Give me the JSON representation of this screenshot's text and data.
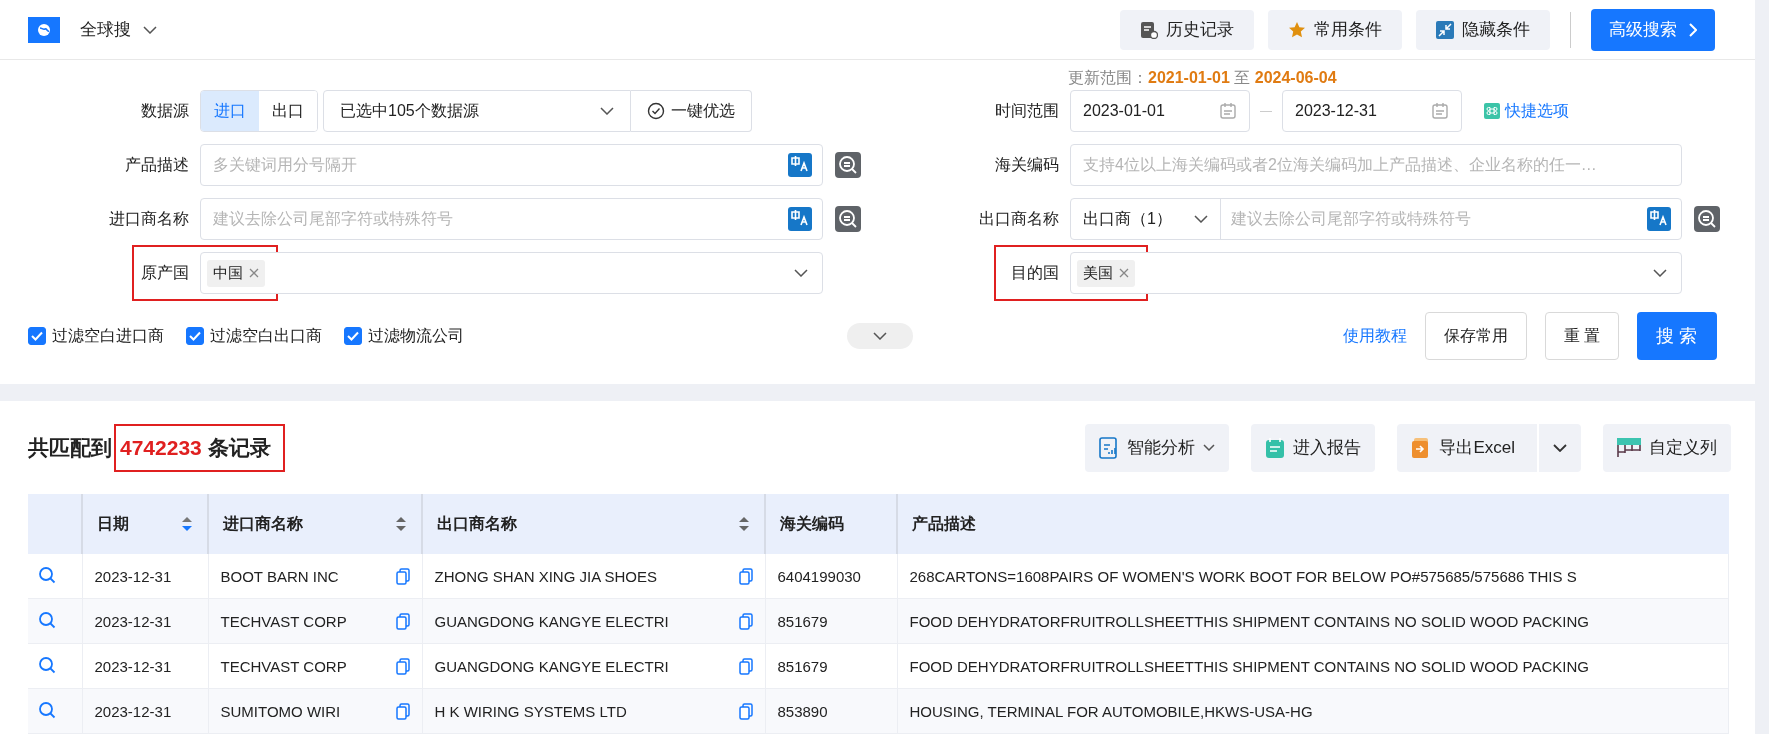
{
  "header": {
    "product": "全球搜",
    "buttons": [
      {
        "label": "历史记录",
        "kind": "history"
      },
      {
        "label": "常用条件",
        "kind": "star"
      },
      {
        "label": "隐藏条件",
        "kind": "collapse"
      }
    ],
    "advanced": "高级搜索"
  },
  "update_range": {
    "label": "更新范围：",
    "from": "2021-01-01",
    "sep": "至",
    "to": "2024-06-04"
  },
  "form_left": [
    {
      "kind": "source",
      "label": "数据源",
      "options": [
        {
          "label": "进口",
          "selected": true
        },
        {
          "label": "出口",
          "selected": false
        }
      ],
      "value": "已选中105个数据源",
      "action": "一键优选"
    },
    {
      "kind": "text",
      "label": "产品描述",
      "placeholder": "多关键词用分号隔开"
    },
    {
      "kind": "text",
      "label": "进口商名称",
      "placeholder": "建议去除公司尾部字符或特殊符号"
    },
    {
      "kind": "tags",
      "label": "原产国",
      "tags": [
        "中国"
      ],
      "highlighted": true
    }
  ],
  "form_right": [
    {
      "kind": "daterange",
      "label": "时间范围",
      "from": "2023-01-01",
      "to": "2023-12-31",
      "shortcut": "快捷选项"
    },
    {
      "kind": "plain",
      "label": "海关编码",
      "placeholder": "支持4位以上海关编码或者2位海关编码加上产品描述、企业名称的任一…"
    },
    {
      "kind": "prefixed",
      "label": "出口商名称",
      "prefix": "出口商（1）",
      "placeholder": "建议去除公司尾部字符或特殊符号"
    },
    {
      "kind": "tags",
      "label": "目的国",
      "tags": [
        "美国"
      ],
      "highlighted": true
    }
  ],
  "filters": [
    {
      "label": "过滤空白进口商",
      "checked": true
    },
    {
      "label": "过滤空白出口商",
      "checked": true
    },
    {
      "label": "过滤物流公司",
      "checked": true
    }
  ],
  "expand_toggle": {
    "expanded": false
  },
  "actions": {
    "tutorial": "使用教程",
    "save": "保存常用",
    "reset": "重 置",
    "search": "搜 索"
  },
  "results": {
    "prefix": "共匹配到",
    "count": "4742233",
    "suffix": "条记录",
    "highlighted": true
  },
  "toolbar": [
    {
      "label": "智能分析",
      "kind": "bi",
      "dropdown": true,
      "split": false
    },
    {
      "label": "进入报告",
      "kind": "report",
      "dropdown": false,
      "split": false
    },
    {
      "label": "导出Excel",
      "kind": "excel",
      "dropdown": false,
      "split": true
    },
    {
      "label": "自定义列",
      "kind": "columns",
      "dropdown": false,
      "split": false
    }
  ],
  "table": {
    "columns": [
      {
        "label": "日期",
        "sortable": true,
        "sorted": true
      },
      {
        "label": "进口商名称",
        "sortable": true,
        "sorted": false
      },
      {
        "label": "出口商名称",
        "sortable": true,
        "sorted": false
      },
      {
        "label": "海关编码",
        "sortable": false
      },
      {
        "label": "产品描述",
        "sortable": false
      }
    ],
    "rows": [
      {
        "cells": [
          "2023-12-31",
          "BOOT BARN INC",
          "ZHONG SHAN XING JIA SHOES",
          "6404199030",
          "268CARTONS=1608PAIRS OF WOMEN'S WORK BOOT FOR BELOW PO#575685/575686 THIS S"
        ]
      },
      {
        "cells": [
          "2023-12-31",
          "TECHVAST CORP",
          "GUANGDONG KANGYE ELECTRI",
          "851679",
          "FOOD DEHYDRATORFRUITROLLSHEETTHIS SHIPMENT CONTAINS NO SOLID WOOD PACKING"
        ]
      },
      {
        "cells": [
          "2023-12-31",
          "TECHVAST CORP",
          "GUANGDONG KANGYE ELECTRI",
          "851679",
          "FOOD DEHYDRATORFRUITROLLSHEETTHIS SHIPMENT CONTAINS NO SOLID WOOD PACKING"
        ]
      },
      {
        "cells": [
          "2023-12-31",
          "SUMITOMO WIRI",
          "H K WIRING SYSTEMS LTD",
          "853890",
          "HOUSING, TERMINAL FOR AUTOMOBILE,HKWS-USA-HG"
        ]
      }
    ]
  }
}
